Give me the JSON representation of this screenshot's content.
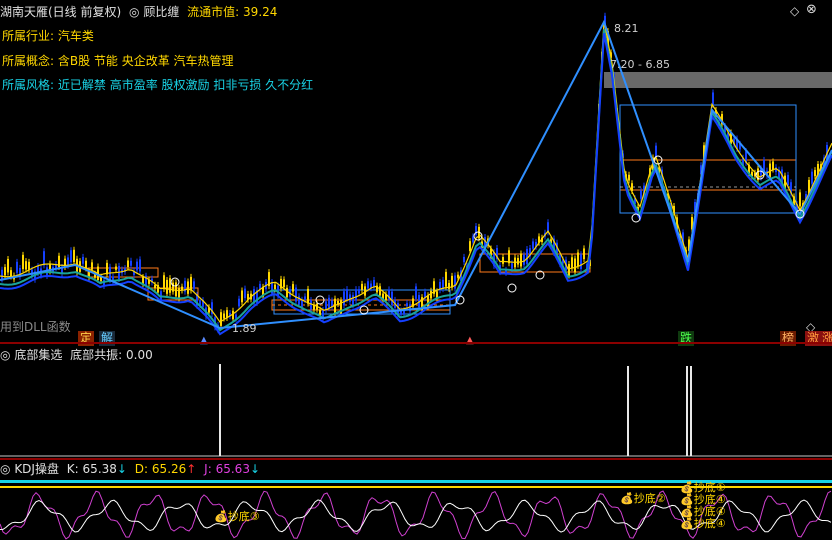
{
  "header": {
    "stock_name": "湖南天雁(日线 前复权)",
    "indicator_name": "顾比缠",
    "market_cap_label": "流通市值:",
    "market_cap_value": "39.24"
  },
  "info": {
    "industry_label": "所属行业:",
    "industry_value": "汽车类",
    "concept_label": "所属概念:",
    "concept_value": "含B股 节能 央企改革 汽车热管理",
    "style_label": "所属风格:",
    "style_value": "近已解禁 高市盈率 股权激励 扣非亏损 久不分红"
  },
  "price_labels": {
    "high": "8.21",
    "range": "7.20 - 6.85",
    "low": "1.89"
  },
  "dll_text": "用到DLL函数",
  "badges": {
    "ding": "定",
    "jie": "解",
    "die": "跌",
    "bang": "榜",
    "ji": "激",
    "zhang": "涨"
  },
  "mid_panel": {
    "title": "底部集选",
    "resonance_label": "底部共振:",
    "resonance_value": "0.00"
  },
  "kdj_panel": {
    "title": "KDJ操盘",
    "k_label": "K:",
    "k_value": "65.38",
    "k_arrow": "↓",
    "d_label": "D:",
    "d_value": "65.26",
    "d_arrow": "↑",
    "j_label": "J:",
    "j_value": "65.63",
    "j_arrow": "↓"
  },
  "markers": {
    "chaodi_1": "抄底①",
    "chaodi_2": "抄底②",
    "chaodi_3": "抄底③",
    "chaodi_4": "抄底④"
  },
  "colors": {
    "up_yellow": "#ffd700",
    "down_blue": "#1540ff",
    "trend_blue": "#2f8fff",
    "teal": "#1aa39a",
    "orange_box": "#ff7a1a",
    "kdj_magenta": "#d040d0",
    "kdj_white": "#ffffff",
    "cyan_band": "#19d3e6"
  }
}
